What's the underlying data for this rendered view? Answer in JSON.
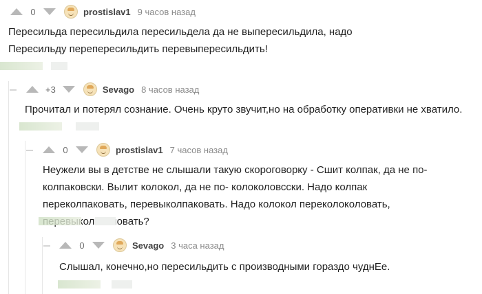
{
  "comments": [
    {
      "rating": "0",
      "username": "prostislav1",
      "time": "9 часов назад",
      "text": "Пересильда пересильдила пересильдела да не выпересильдила, надо Пересильду перепересильдить перевыпересильдить!"
    },
    {
      "rating": "+3",
      "username": "Sevago",
      "time": "8 часов назад",
      "text": "Прочитал и потерял сознание. Очень круто звучит,но на обработку оперативки не хватило."
    },
    {
      "rating": "0",
      "username": "prostislav1",
      "time": "7 часов назад",
      "text": "Неужели вы в детстве не слышали такую скороговорку - Сшит колпак, да не по-колпаковски. Вылит колокол, да не по- колоколовсски. Надо колпак переколпаковать, перевыколпаковать. Надо колокол переколоколовать, перевыколоколовать?"
    },
    {
      "rating": "0",
      "username": "Sevago",
      "time": "3 часа назад",
      "text": "Слышал, конечно,но пересильдить с производными гораздо чуднЕе."
    }
  ],
  "icons": {
    "upvote": "arrow-up-icon",
    "downvote": "arrow-down-icon",
    "avatar": "user-avatar-icon"
  }
}
